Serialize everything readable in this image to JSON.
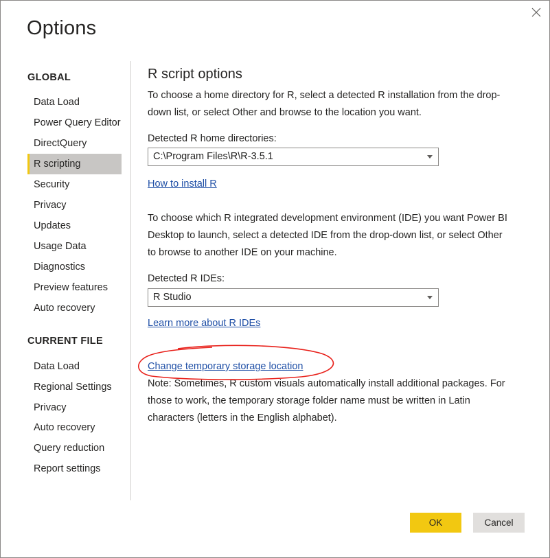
{
  "dialog": {
    "title": "Options",
    "close_icon": "close-icon"
  },
  "sidebar": {
    "global_heading": "GLOBAL",
    "global_items": [
      {
        "label": "Data Load"
      },
      {
        "label": "Power Query Editor"
      },
      {
        "label": "DirectQuery"
      },
      {
        "label": "R scripting",
        "active": true
      },
      {
        "label": "Security"
      },
      {
        "label": "Privacy"
      },
      {
        "label": "Updates"
      },
      {
        "label": "Usage Data"
      },
      {
        "label": "Diagnostics"
      },
      {
        "label": "Preview features"
      },
      {
        "label": "Auto recovery"
      }
    ],
    "current_heading": "CURRENT FILE",
    "current_items": [
      {
        "label": "Data Load"
      },
      {
        "label": "Regional Settings"
      },
      {
        "label": "Privacy"
      },
      {
        "label": "Auto recovery"
      },
      {
        "label": "Query reduction"
      },
      {
        "label": "Report settings"
      }
    ]
  },
  "main": {
    "heading": "R script options",
    "intro_home": "To choose a home directory for R, select a detected R installation from the drop-down list, or select Other and browse to the location you want.",
    "home_label": "Detected R home directories:",
    "home_value": "C:\\Program Files\\R\\R-3.5.1",
    "install_link": "How to install R",
    "intro_ide": "To choose which R integrated development environment (IDE) you want Power BI Desktop to launch, select a detected IDE from the drop-down list, or select Other to browse to another IDE on your machine.",
    "ide_label": "Detected R IDEs:",
    "ide_value": "R Studio",
    "ide_link": "Learn more about R IDEs",
    "storage_link": "Change temporary storage location",
    "note": "Note: Sometimes, R custom visuals automatically install additional packages. For those to work, the temporary storage folder name must be written in Latin characters (letters in the English alphabet)."
  },
  "footer": {
    "ok_label": "OK",
    "cancel_label": "Cancel"
  },
  "colors": {
    "accent": "#f2c811",
    "link": "#1f4fa6",
    "annotation": "#e8201a",
    "active_bg": "#c8c6c4"
  }
}
